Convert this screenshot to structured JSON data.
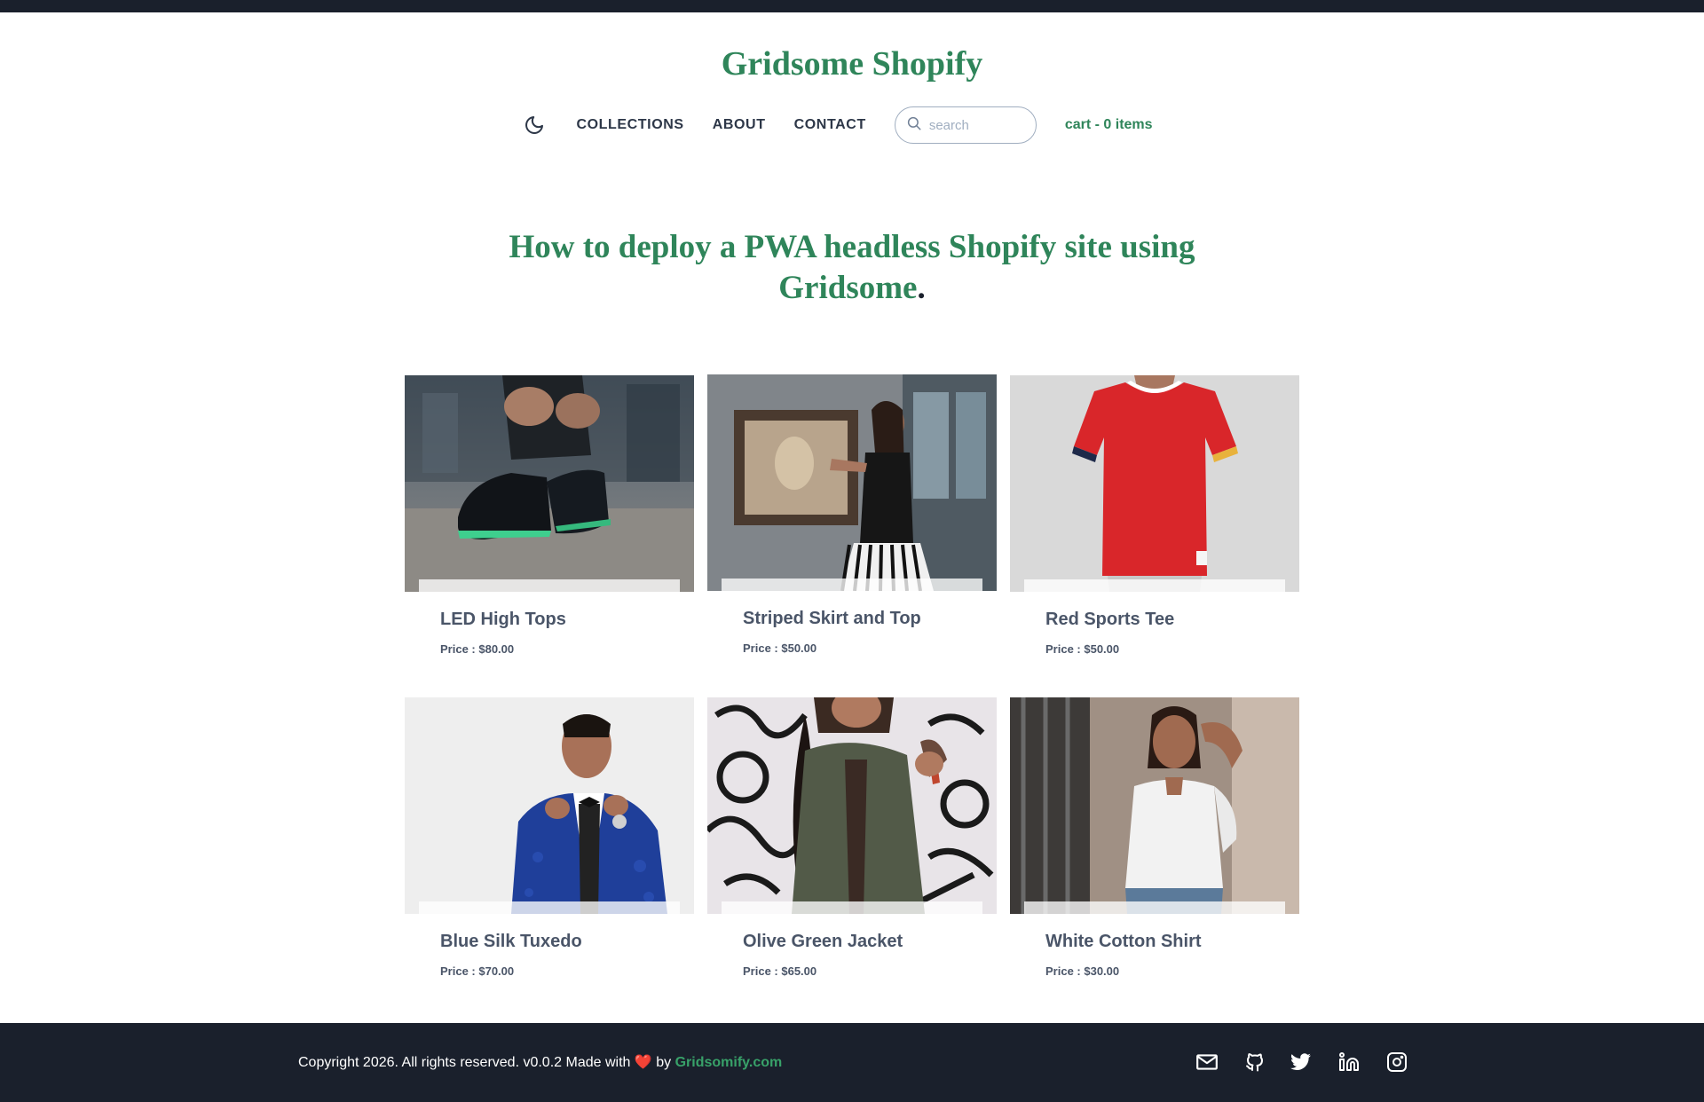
{
  "header": {
    "title": "Gridsome Shopify",
    "nav": {
      "theme_icon": "moon-icon",
      "links": [
        "COLLECTIONS",
        "ABOUT",
        "CONTACT"
      ],
      "search_placeholder": "search",
      "search_value": "",
      "cart_label": "cart - 0 items"
    }
  },
  "hero": {
    "headline": "How to deploy a PWA headless Shopify site using Gridsome",
    "headline_end": "."
  },
  "products": [
    {
      "name": "LED High Tops",
      "price": "Price : $80.00"
    },
    {
      "name": "Striped Skirt and Top",
      "price": "Price : $50.00"
    },
    {
      "name": "Red Sports Tee",
      "price": "Price : $50.00"
    },
    {
      "name": "Blue Silk Tuxedo",
      "price": "Price : $70.00"
    },
    {
      "name": "Olive Green Jacket",
      "price": "Price : $65.00"
    },
    {
      "name": "White Cotton Shirt",
      "price": "Price : $30.00"
    }
  ],
  "footer": {
    "copyright": "Copyright 2026. All rights reserved. v0.0.2 Made with",
    "heart": "❤️",
    "by": "by",
    "brand": "Gridsomify.com",
    "social_icons": [
      "mail-icon",
      "github-icon",
      "twitter-icon",
      "linkedin-icon",
      "instagram-icon"
    ]
  },
  "colors": {
    "accent": "#2f855a",
    "footer_bg": "#1a202c",
    "text": "#4a5568"
  }
}
